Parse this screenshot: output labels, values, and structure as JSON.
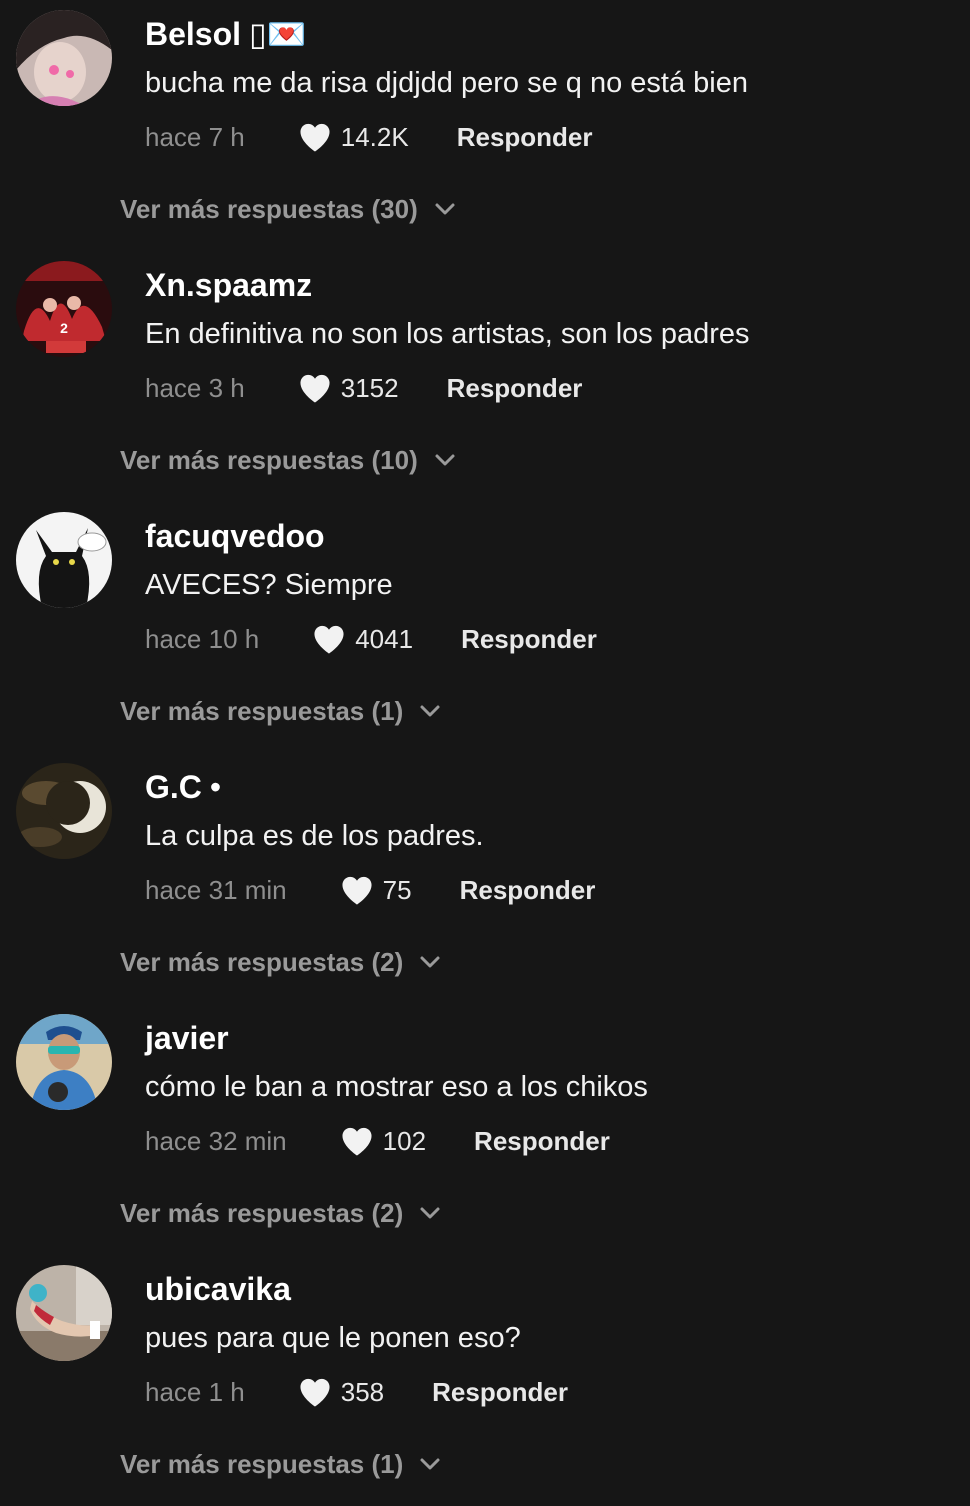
{
  "comments": [
    {
      "username": "Belsol",
      "username_suffix": "▯💌",
      "text": "bucha me da risa djdjdd pero se q no está bien",
      "time": "hace 7 h",
      "likes": "14.2K",
      "reply_label": "Responder",
      "more_replies": "Ver más respuestas (30)"
    },
    {
      "username": "Xn.spaamz",
      "username_suffix": "",
      "text": "En definitiva no son los artistas, son los padres",
      "time": "hace 3 h",
      "likes": "3152",
      "reply_label": "Responder",
      "more_replies": "Ver más respuestas (10)"
    },
    {
      "username": "facuqvedoo",
      "username_suffix": "",
      "text": "AVECES? Siempre",
      "time": "hace 10 h",
      "likes": "4041",
      "reply_label": "Responder",
      "more_replies": "Ver más respuestas (1)"
    },
    {
      "username": "G.C",
      "username_suffix": "•",
      "text": "La culpa es de los padres.",
      "time": "hace 31 min",
      "likes": "75",
      "reply_label": "Responder",
      "more_replies": "Ver más respuestas (2)"
    },
    {
      "username": "javier",
      "username_suffix": "",
      "text": "cómo le ban a mostrar eso a los chikos",
      "time": "hace 32 min",
      "likes": "102",
      "reply_label": "Responder",
      "more_replies": "Ver más respuestas (2)"
    },
    {
      "username": "ubicavika",
      "username_suffix": "",
      "text": "pues para que le ponen eso?",
      "time": "hace 1 h",
      "likes": "358",
      "reply_label": "Responder",
      "more_replies": "Ver más respuestas (1)"
    }
  ],
  "colors": {
    "background": "#161616",
    "text_primary": "#ffffff",
    "text_muted": "#8f8f8f",
    "more_replies": "#9a9a9a"
  }
}
